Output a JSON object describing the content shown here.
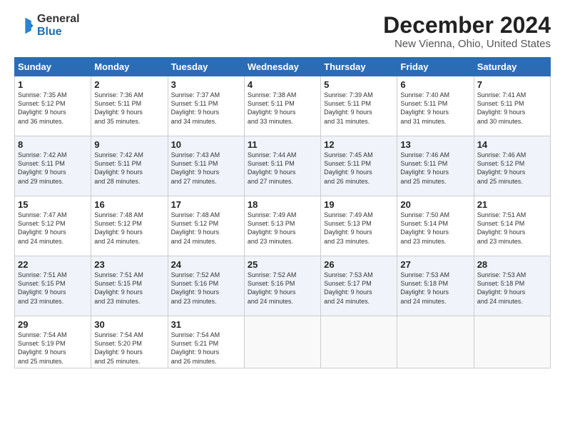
{
  "header": {
    "logo_general": "General",
    "logo_blue": "Blue",
    "title": "December 2024",
    "subtitle": "New Vienna, Ohio, United States"
  },
  "days_of_week": [
    "Sunday",
    "Monday",
    "Tuesday",
    "Wednesday",
    "Thursday",
    "Friday",
    "Saturday"
  ],
  "weeks": [
    [
      {
        "day": "1",
        "lines": [
          "Sunrise: 7:35 AM",
          "Sunset: 5:12 PM",
          "Daylight: 9 hours",
          "and 36 minutes."
        ]
      },
      {
        "day": "2",
        "lines": [
          "Sunrise: 7:36 AM",
          "Sunset: 5:11 PM",
          "Daylight: 9 hours",
          "and 35 minutes."
        ]
      },
      {
        "day": "3",
        "lines": [
          "Sunrise: 7:37 AM",
          "Sunset: 5:11 PM",
          "Daylight: 9 hours",
          "and 34 minutes."
        ]
      },
      {
        "day": "4",
        "lines": [
          "Sunrise: 7:38 AM",
          "Sunset: 5:11 PM",
          "Daylight: 9 hours",
          "and 33 minutes."
        ]
      },
      {
        "day": "5",
        "lines": [
          "Sunrise: 7:39 AM",
          "Sunset: 5:11 PM",
          "Daylight: 9 hours",
          "and 31 minutes."
        ]
      },
      {
        "day": "6",
        "lines": [
          "Sunrise: 7:40 AM",
          "Sunset: 5:11 PM",
          "Daylight: 9 hours",
          "and 31 minutes."
        ]
      },
      {
        "day": "7",
        "lines": [
          "Sunrise: 7:41 AM",
          "Sunset: 5:11 PM",
          "Daylight: 9 hours",
          "and 30 minutes."
        ]
      }
    ],
    [
      {
        "day": "8",
        "lines": [
          "Sunrise: 7:42 AM",
          "Sunset: 5:11 PM",
          "Daylight: 9 hours",
          "and 29 minutes."
        ]
      },
      {
        "day": "9",
        "lines": [
          "Sunrise: 7:42 AM",
          "Sunset: 5:11 PM",
          "Daylight: 9 hours",
          "and 28 minutes."
        ]
      },
      {
        "day": "10",
        "lines": [
          "Sunrise: 7:43 AM",
          "Sunset: 5:11 PM",
          "Daylight: 9 hours",
          "and 27 minutes."
        ]
      },
      {
        "day": "11",
        "lines": [
          "Sunrise: 7:44 AM",
          "Sunset: 5:11 PM",
          "Daylight: 9 hours",
          "and 27 minutes."
        ]
      },
      {
        "day": "12",
        "lines": [
          "Sunrise: 7:45 AM",
          "Sunset: 5:11 PM",
          "Daylight: 9 hours",
          "and 26 minutes."
        ]
      },
      {
        "day": "13",
        "lines": [
          "Sunrise: 7:46 AM",
          "Sunset: 5:11 PM",
          "Daylight: 9 hours",
          "and 25 minutes."
        ]
      },
      {
        "day": "14",
        "lines": [
          "Sunrise: 7:46 AM",
          "Sunset: 5:12 PM",
          "Daylight: 9 hours",
          "and 25 minutes."
        ]
      }
    ],
    [
      {
        "day": "15",
        "lines": [
          "Sunrise: 7:47 AM",
          "Sunset: 5:12 PM",
          "Daylight: 9 hours",
          "and 24 minutes."
        ]
      },
      {
        "day": "16",
        "lines": [
          "Sunrise: 7:48 AM",
          "Sunset: 5:12 PM",
          "Daylight: 9 hours",
          "and 24 minutes."
        ]
      },
      {
        "day": "17",
        "lines": [
          "Sunrise: 7:48 AM",
          "Sunset: 5:12 PM",
          "Daylight: 9 hours",
          "and 24 minutes."
        ]
      },
      {
        "day": "18",
        "lines": [
          "Sunrise: 7:49 AM",
          "Sunset: 5:13 PM",
          "Daylight: 9 hours",
          "and 23 minutes."
        ]
      },
      {
        "day": "19",
        "lines": [
          "Sunrise: 7:49 AM",
          "Sunset: 5:13 PM",
          "Daylight: 9 hours",
          "and 23 minutes."
        ]
      },
      {
        "day": "20",
        "lines": [
          "Sunrise: 7:50 AM",
          "Sunset: 5:14 PM",
          "Daylight: 9 hours",
          "and 23 minutes."
        ]
      },
      {
        "day": "21",
        "lines": [
          "Sunrise: 7:51 AM",
          "Sunset: 5:14 PM",
          "Daylight: 9 hours",
          "and 23 minutes."
        ]
      }
    ],
    [
      {
        "day": "22",
        "lines": [
          "Sunrise: 7:51 AM",
          "Sunset: 5:15 PM",
          "Daylight: 9 hours",
          "and 23 minutes."
        ]
      },
      {
        "day": "23",
        "lines": [
          "Sunrise: 7:51 AM",
          "Sunset: 5:15 PM",
          "Daylight: 9 hours",
          "and 23 minutes."
        ]
      },
      {
        "day": "24",
        "lines": [
          "Sunrise: 7:52 AM",
          "Sunset: 5:16 PM",
          "Daylight: 9 hours",
          "and 23 minutes."
        ]
      },
      {
        "day": "25",
        "lines": [
          "Sunrise: 7:52 AM",
          "Sunset: 5:16 PM",
          "Daylight: 9 hours",
          "and 24 minutes."
        ]
      },
      {
        "day": "26",
        "lines": [
          "Sunrise: 7:53 AM",
          "Sunset: 5:17 PM",
          "Daylight: 9 hours",
          "and 24 minutes."
        ]
      },
      {
        "day": "27",
        "lines": [
          "Sunrise: 7:53 AM",
          "Sunset: 5:18 PM",
          "Daylight: 9 hours",
          "and 24 minutes."
        ]
      },
      {
        "day": "28",
        "lines": [
          "Sunrise: 7:53 AM",
          "Sunset: 5:18 PM",
          "Daylight: 9 hours",
          "and 24 minutes."
        ]
      }
    ],
    [
      {
        "day": "29",
        "lines": [
          "Sunrise: 7:54 AM",
          "Sunset: 5:19 PM",
          "Daylight: 9 hours",
          "and 25 minutes."
        ]
      },
      {
        "day": "30",
        "lines": [
          "Sunrise: 7:54 AM",
          "Sunset: 5:20 PM",
          "Daylight: 9 hours",
          "and 25 minutes."
        ]
      },
      {
        "day": "31",
        "lines": [
          "Sunrise: 7:54 AM",
          "Sunset: 5:21 PM",
          "Daylight: 9 hours",
          "and 26 minutes."
        ]
      },
      null,
      null,
      null,
      null
    ]
  ]
}
